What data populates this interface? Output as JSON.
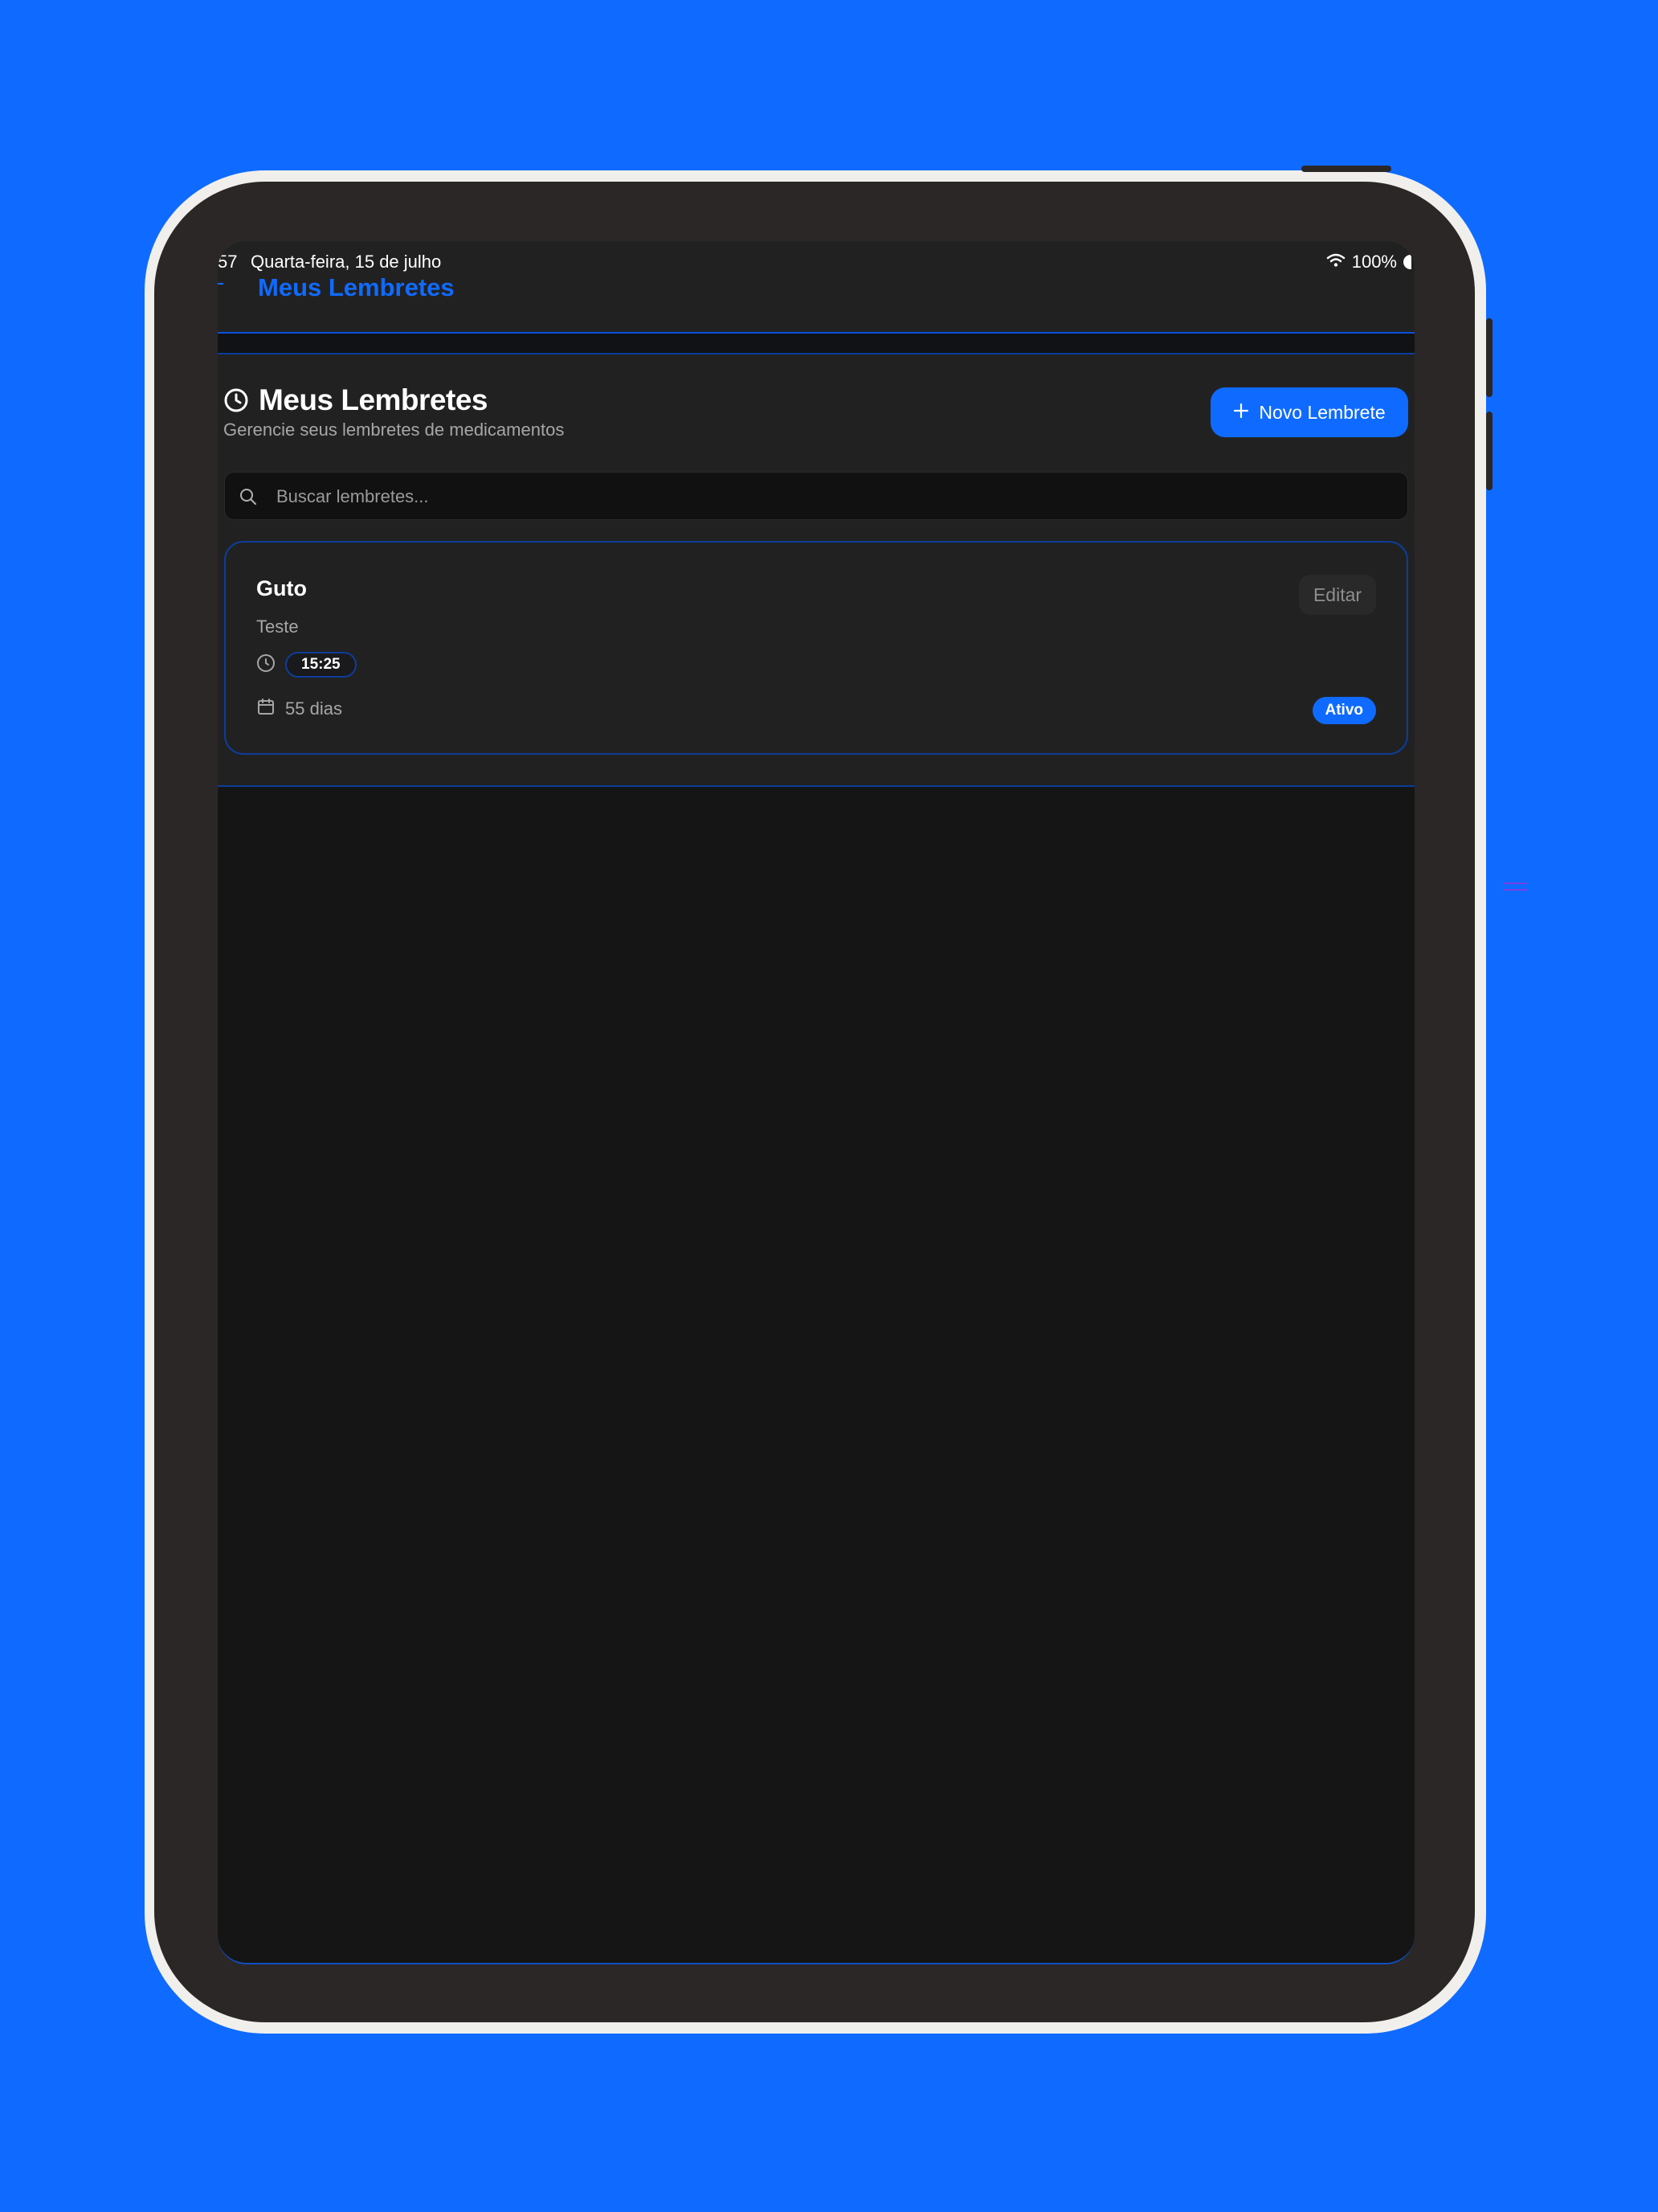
{
  "status_bar": {
    "time": "57",
    "date": "Quarta-feira, 15 de julho",
    "battery": "100%"
  },
  "nav": {
    "title": "Meus Lembretes"
  },
  "header": {
    "title": "Meus Lembretes",
    "subtitle": "Gerencie seus lembretes de medicamentos",
    "new_button_label": "Novo Lembrete"
  },
  "search": {
    "placeholder": "Buscar lembretes..."
  },
  "reminders": [
    {
      "title": "Guto",
      "description": "Teste",
      "time": "15:25",
      "duration": "55 dias",
      "status": "Ativo",
      "edit_label": "Editar"
    }
  ],
  "colors": {
    "accent": "#0f6bff",
    "background": "#151515",
    "panel": "#222122"
  },
  "icons": [
    "wifi-icon",
    "battery-icon",
    "clock-icon",
    "plus-icon",
    "search-icon",
    "calendar-icon"
  ]
}
